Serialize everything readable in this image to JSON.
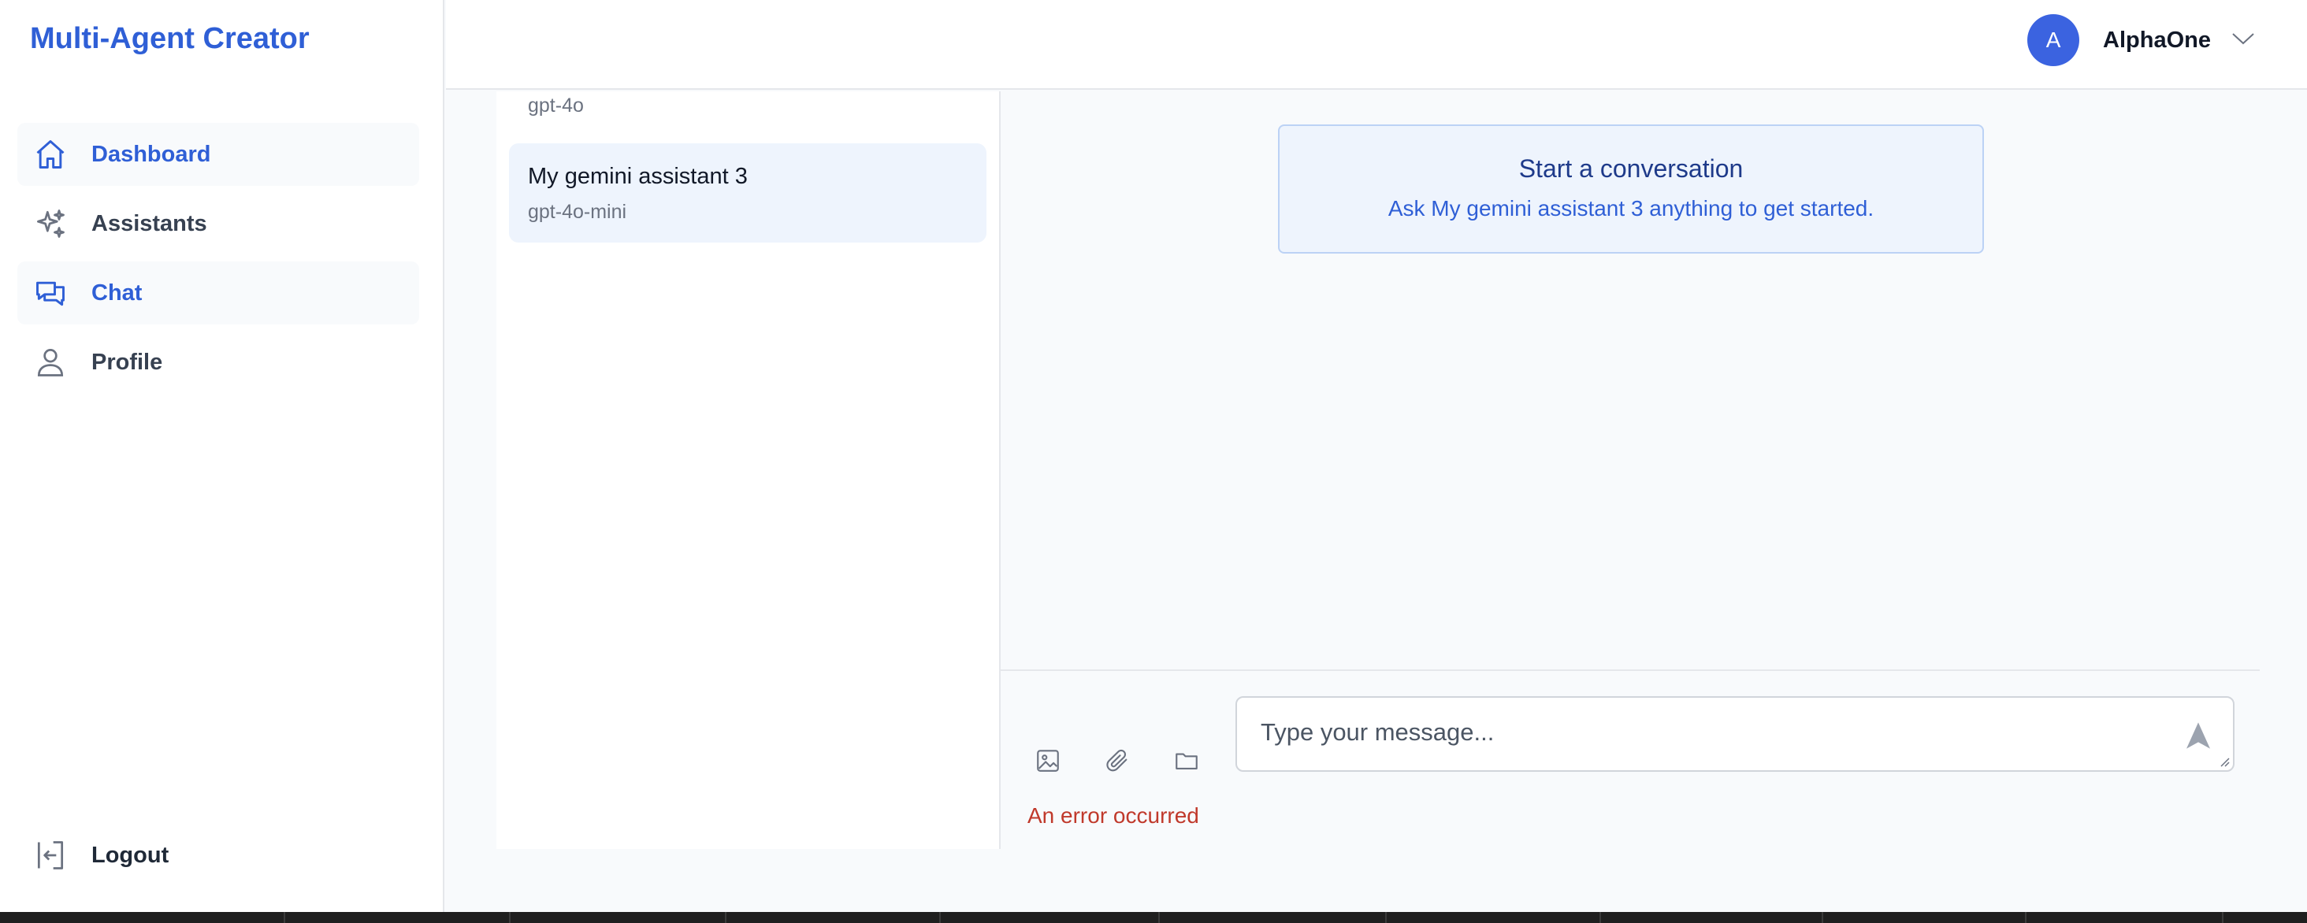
{
  "app": {
    "title": "Multi-Agent Creator"
  },
  "sidebar": {
    "items": [
      {
        "label": "Dashboard",
        "icon": "home-icon",
        "active": true
      },
      {
        "label": "Assistants",
        "icon": "sparkles-icon",
        "active": false
      },
      {
        "label": "Chat",
        "icon": "chat-bubbles-icon",
        "active": true
      },
      {
        "label": "Profile",
        "icon": "user-icon",
        "active": false
      }
    ],
    "logout": {
      "label": "Logout",
      "icon": "logout-icon"
    }
  },
  "header": {
    "user": {
      "initial": "A",
      "name": "AlphaOne",
      "icon": "chevron-down-icon"
    }
  },
  "assistant_list": {
    "partial_item_model": "gpt-4o",
    "selected": {
      "name": "My gemini assistant 3",
      "model": "gpt-4o-mini"
    }
  },
  "chat": {
    "welcome": {
      "heading": "Start a conversation",
      "subtitle": "Ask My gemini assistant 3 anything to get started."
    },
    "composer": {
      "placeholder": "Type your message...",
      "tools": [
        "image-icon",
        "paperclip-icon",
        "folder-icon"
      ],
      "send_icon": "send-icon"
    },
    "error": "An error occurred"
  },
  "colors": {
    "accent": "#2f5fd6",
    "avatar": "#3b63e0",
    "selected_bg": "#eef4fd",
    "error": "#c0392b"
  }
}
